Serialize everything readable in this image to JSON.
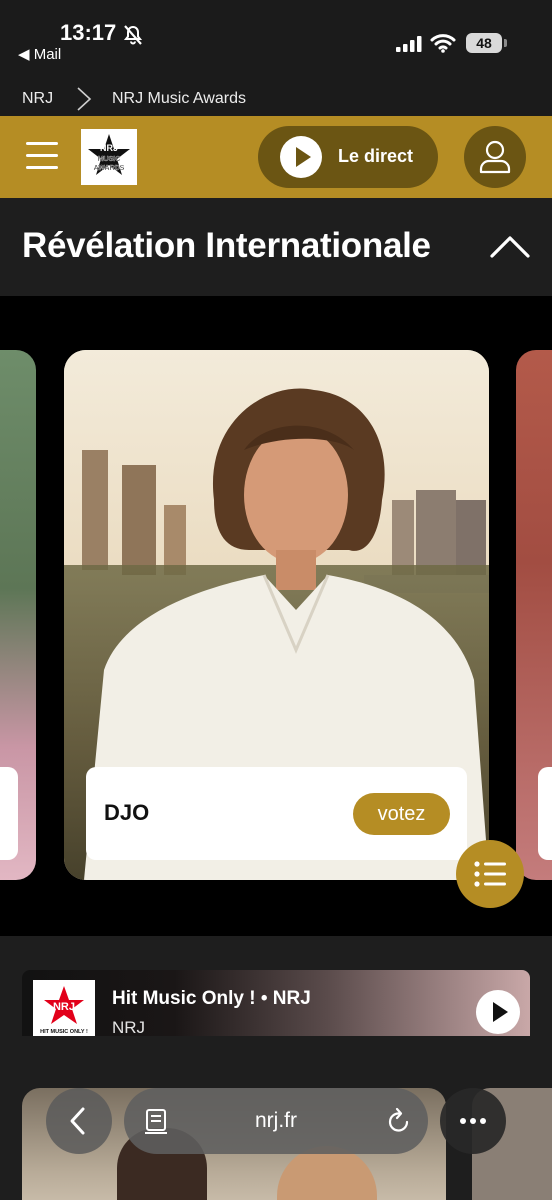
{
  "status_bar": {
    "time": "13:17",
    "back_app": "◀ Mail",
    "battery": "48"
  },
  "breadcrumb": {
    "items": [
      {
        "label": "NRJ"
      },
      {
        "label": "NRJ Music Awards"
      }
    ]
  },
  "header": {
    "live_label": "Le direct",
    "logo_text": "NRJ MUSIC AWARDS",
    "accent_color": "#b58d24"
  },
  "category": {
    "title": "Révélation Internationale"
  },
  "carousel": {
    "current_artist": {
      "name": "DJO",
      "vote_label": "votez"
    }
  },
  "player": {
    "title": "Hit Music Only ! • NRJ",
    "subtitle": "NRJ",
    "logo_text": "NRJ",
    "logo_tagline": "HIT MUSIC ONLY !"
  },
  "browser": {
    "url": "nrj.fr"
  }
}
